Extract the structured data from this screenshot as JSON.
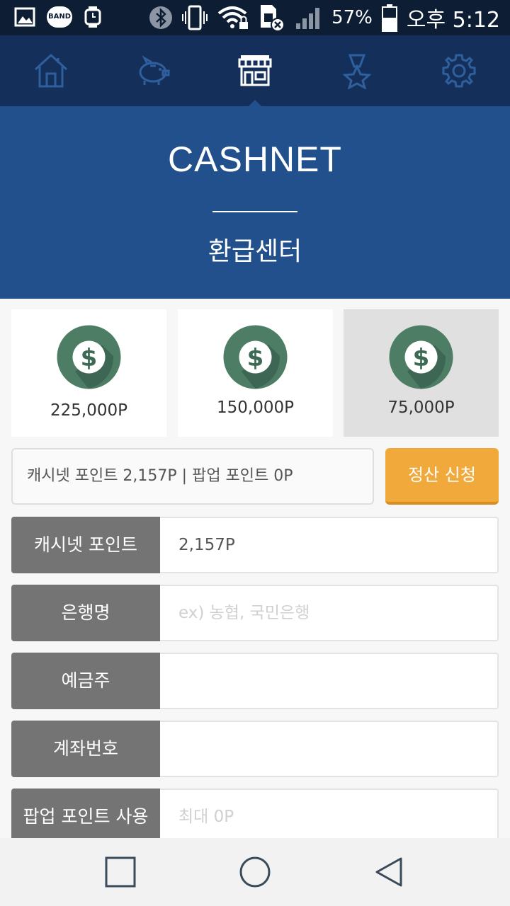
{
  "status_bar": {
    "battery_percent": "57%",
    "clock": "오후 5:12",
    "band_label": "BAND"
  },
  "nav": {
    "items": [
      "home-icon",
      "piggy-bank-icon",
      "store-icon",
      "medal-icon",
      "gear-icon"
    ],
    "active_index": 2
  },
  "header": {
    "brand": "CASHNET",
    "title": "환급센터"
  },
  "amounts": [
    {
      "label": "225,000P",
      "selected": false
    },
    {
      "label": "150,000P",
      "selected": false
    },
    {
      "label": "75,000P",
      "selected": true
    }
  ],
  "summary": {
    "text": "캐시넷 포인트 2,157P | 팝업 포인트 0P",
    "apply_label": "정산 신청"
  },
  "form": {
    "cashnet_points": {
      "label": "캐시넷 포인트",
      "value": "2,157P"
    },
    "bank_name": {
      "label": "은행명",
      "placeholder": "ex) 농협, 국민은행"
    },
    "depositor": {
      "label": "예금주",
      "placeholder": ""
    },
    "account_number": {
      "label": "계좌번호",
      "placeholder": ""
    },
    "popup_points": {
      "label": "팝업 포인트 사용",
      "placeholder": "최대 0P"
    }
  },
  "colors": {
    "status_bar": "#0d1d33",
    "nav_bg": "#14305a",
    "banner_bg": "#21508c",
    "accent_orange": "#f2a93b",
    "coin_green": "#4e7d65",
    "label_gray": "#747474"
  }
}
